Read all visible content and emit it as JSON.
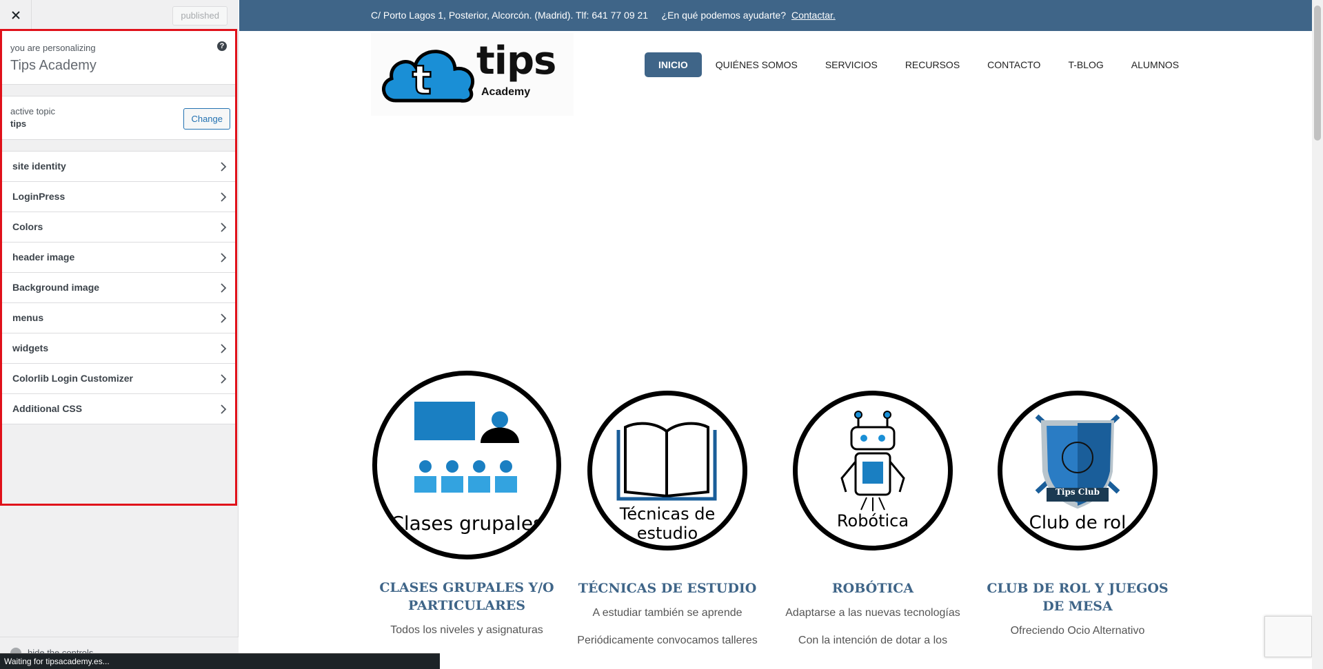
{
  "customizer": {
    "close_label": "Close",
    "publish_label": "published",
    "personalizing_label": "you are personalizing",
    "site_title": "Tips Academy",
    "help_glyph": "?",
    "active_theme_label": "active topic",
    "active_theme_name": "tips",
    "change_label": "Change",
    "sections": [
      {
        "label": "site identity"
      },
      {
        "label": "LoginPress"
      },
      {
        "label": "Colors"
      },
      {
        "label": "header image"
      },
      {
        "label": "Background image"
      },
      {
        "label": "menus"
      },
      {
        "label": "widgets"
      },
      {
        "label": "Colorlib Login Customizer"
      },
      {
        "label": "Additional CSS"
      }
    ],
    "hide_controls_label": "hide the controls",
    "status_text": "Waiting for tipsacademy.es..."
  },
  "site": {
    "topbar_text": "C/ Porto Lagos 1, Posterior, Alcorcón. (Madrid). Tlf: 641 77 09 21     ¿En qué podemos ayudarte?",
    "topbar_contact": "Contactar.",
    "logo_word": "tips",
    "logo_sub": "Academy",
    "nav": [
      {
        "label": "INICIO",
        "active": true
      },
      {
        "label": "QUIÉNES SOMOS",
        "active": false
      },
      {
        "label": "SERVICIOS",
        "active": false
      },
      {
        "label": "RECURSOS",
        "active": false
      },
      {
        "label": "CONTACTO",
        "active": false
      },
      {
        "label": "T-BLOG",
        "active": false
      },
      {
        "label": "ALUMNOS",
        "active": false
      }
    ],
    "services": [
      {
        "circle_text": "Clases grupales",
        "title": "CLASES GRUPALES Y/O PARTICULARES",
        "subtitle": "Todos los niveles y asignaturas",
        "extra": ""
      },
      {
        "circle_text": "Técnicas de estudio",
        "title": "TÉCNICAS DE ESTUDIO",
        "subtitle": "A estudiar también se aprende",
        "extra": "Periódicamente convocamos talleres"
      },
      {
        "circle_text": "Robótica",
        "title": "ROBÓTICA",
        "subtitle": "Adaptarse a las nuevas tecnologías",
        "extra": "Con la intención de dotar a los"
      },
      {
        "circle_text": "Club de rol",
        "title": "CLUB DE ROL Y JUEGOS DE MESA",
        "subtitle": "Ofreciendo Ocio Alternativo",
        "extra": "",
        "badge": "Tips Club"
      }
    ],
    "colors": {
      "primary": "#3f6588",
      "accent_blue": "#1a8fd6",
      "highlight_red": "#e0111a"
    }
  }
}
